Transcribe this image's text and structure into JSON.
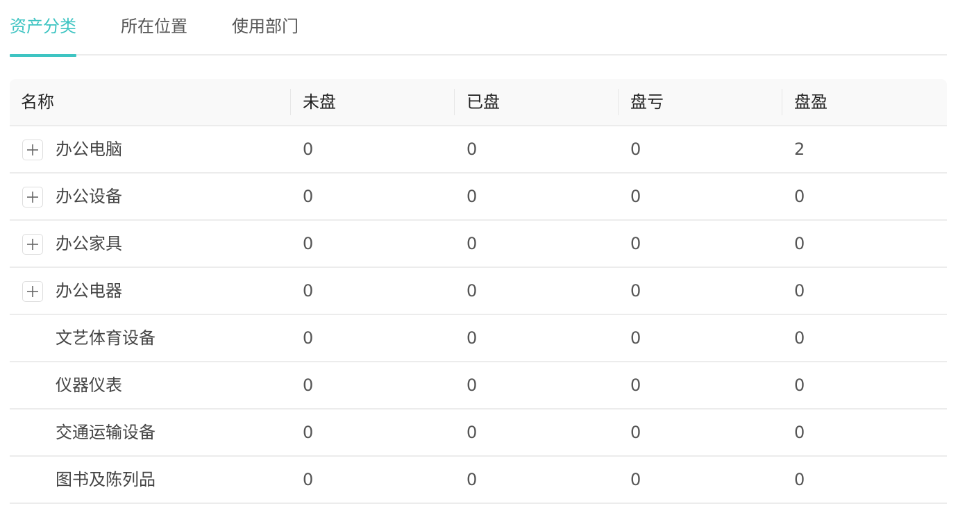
{
  "tabs": [
    {
      "label": "资产分类",
      "active": true
    },
    {
      "label": "所在位置",
      "active": false
    },
    {
      "label": "使用部门",
      "active": false
    }
  ],
  "table": {
    "columns": [
      "名称",
      "未盘",
      "已盘",
      "盘亏",
      "盘盈"
    ],
    "rows": [
      {
        "name": "办公电脑",
        "expandable": true,
        "values": [
          "0",
          "0",
          "0",
          "2"
        ]
      },
      {
        "name": "办公设备",
        "expandable": true,
        "values": [
          "0",
          "0",
          "0",
          "0"
        ]
      },
      {
        "name": "办公家具",
        "expandable": true,
        "values": [
          "0",
          "0",
          "0",
          "0"
        ]
      },
      {
        "name": "办公电器",
        "expandable": true,
        "values": [
          "0",
          "0",
          "0",
          "0"
        ]
      },
      {
        "name": "文艺体育设备",
        "expandable": false,
        "values": [
          "0",
          "0",
          "0",
          "0"
        ]
      },
      {
        "name": "仪器仪表",
        "expandable": false,
        "values": [
          "0",
          "0",
          "0",
          "0"
        ]
      },
      {
        "name": "交通运输设备",
        "expandable": false,
        "values": [
          "0",
          "0",
          "0",
          "0"
        ]
      },
      {
        "name": "图书及陈列品",
        "expandable": false,
        "values": [
          "0",
          "0",
          "0",
          "0"
        ]
      }
    ]
  },
  "colors": {
    "accent": "#3ec4c2",
    "header_bg": "#f9f9f9",
    "border": "#ececec"
  },
  "icons": {
    "expand": "plus-icon"
  }
}
